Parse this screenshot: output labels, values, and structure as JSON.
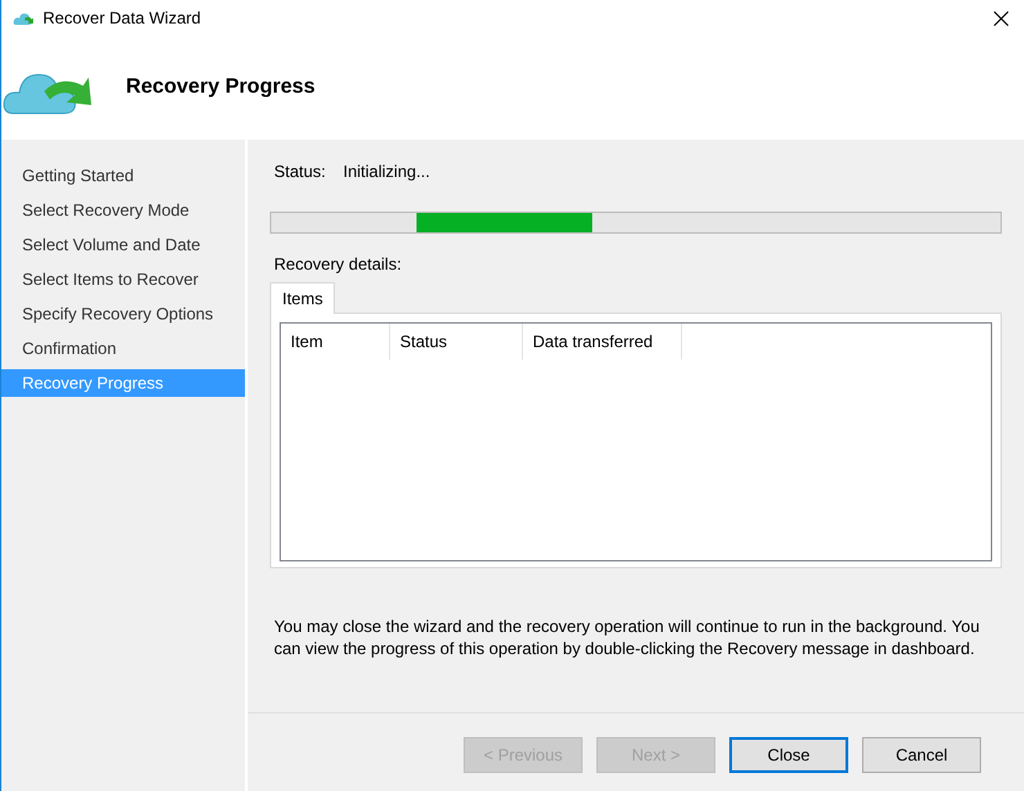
{
  "window": {
    "title": "Recover Data Wizard"
  },
  "header": {
    "title": "Recovery Progress"
  },
  "steps": [
    {
      "label": "Getting Started",
      "selected": false
    },
    {
      "label": "Select Recovery Mode",
      "selected": false
    },
    {
      "label": "Select Volume and Date",
      "selected": false
    },
    {
      "label": "Select Items to Recover",
      "selected": false
    },
    {
      "label": "Specify Recovery Options",
      "selected": false
    },
    {
      "label": "Confirmation",
      "selected": false
    },
    {
      "label": "Recovery Progress",
      "selected": true
    }
  ],
  "status": {
    "label": "Status:",
    "value": "Initializing..."
  },
  "progress": {
    "indeterminate": true
  },
  "details_label": "Recovery details:",
  "tabs": [
    {
      "label": "Items",
      "selected": true
    }
  ],
  "table": {
    "columns": [
      "Item",
      "Status",
      "Data transferred"
    ]
  },
  "note": "You may close the wizard and the recovery operation will continue to run in the background. You can view the progress of this operation by double-clicking the Recovery message in dashboard.",
  "buttons": [
    {
      "label": "< Previous",
      "disabled": true,
      "default": false
    },
    {
      "label": "Next >",
      "disabled": true,
      "default": false
    },
    {
      "label": "Close",
      "disabled": false,
      "default": true
    },
    {
      "label": "Cancel",
      "disabled": false,
      "default": false
    }
  ]
}
